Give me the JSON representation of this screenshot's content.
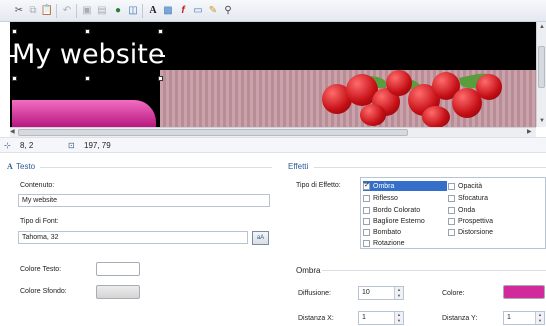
{
  "toolbar": {
    "icons": [
      "cut-icon",
      "copy-icon",
      "paste-icon",
      "undo-icon",
      "bring-front-icon",
      "send-back-icon",
      "insert-link-icon",
      "insert-layer-icon",
      "text-icon",
      "image-icon",
      "flash-icon",
      "comment-icon",
      "edit-icon",
      "find-icon"
    ],
    "font_glyph": "A",
    "flash_glyph": "f"
  },
  "canvas": {
    "site_title": "My website"
  },
  "status": {
    "position": "8, 2",
    "size": "197, 79"
  },
  "testo": {
    "section_title": "Testo",
    "content_label": "Contenuto:",
    "content_value": "My website",
    "font_label": "Tipo di Font:",
    "font_value": "Tahoma, 32",
    "text_color_label": "Colore Testo:",
    "bg_color_label": "Colore Sfondo:",
    "text_color": "#ffffff",
    "bg_color": "#e0e0e0"
  },
  "effetti": {
    "section_title": "Effetti",
    "type_label": "Tipo di Effetto:",
    "col1": [
      {
        "label": "Ombra",
        "checked": true
      },
      {
        "label": "Riflesso",
        "checked": false
      },
      {
        "label": "Bordo Colorato",
        "checked": false
      },
      {
        "label": "Bagliore Esterno",
        "checked": false
      },
      {
        "label": "Bombato",
        "checked": false
      },
      {
        "label": "Rotazione",
        "checked": false
      }
    ],
    "col2": [
      {
        "label": "Opacità",
        "checked": false
      },
      {
        "label": "Sfocatura",
        "checked": false
      },
      {
        "label": "Onda",
        "checked": false
      },
      {
        "label": "Prospettiva",
        "checked": false
      },
      {
        "label": "Distorsione",
        "checked": false
      }
    ]
  },
  "ombra": {
    "section_title": "Ombra",
    "diffusion_label": "Diffusione:",
    "diffusion_value": "10",
    "color_label": "Colore:",
    "color": "#d12a9b",
    "dx_label": "Distanza X:",
    "dx_value": "1",
    "dy_label": "Distanza Y:",
    "dy_value": "1"
  },
  "colors": {
    "accent": "#2c5a9a",
    "selection": "#3470c9",
    "brand_pink": "#d12a9b"
  }
}
